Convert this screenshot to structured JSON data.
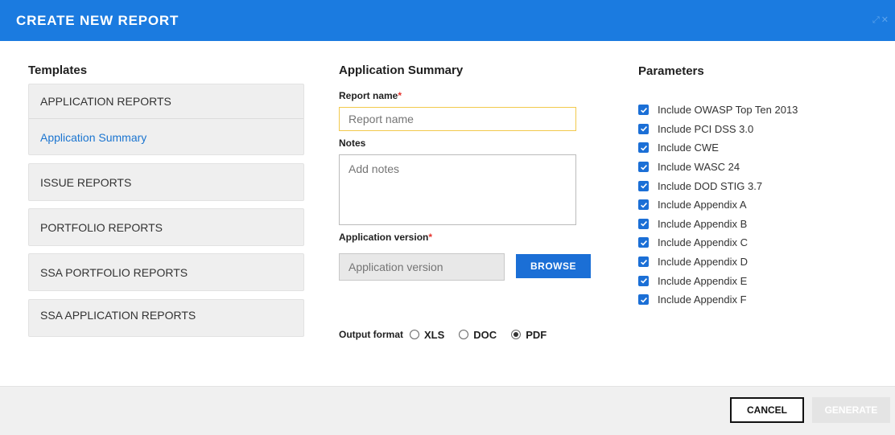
{
  "dialog": {
    "title": "CREATE NEW REPORT",
    "accent": "#1b7be0"
  },
  "templates": {
    "heading": "Templates",
    "groups": [
      {
        "label": "APPLICATION REPORTS",
        "items": [
          "Application Summary"
        ]
      },
      {
        "label": "ISSUE REPORTS"
      },
      {
        "label": "PORTFOLIO REPORTS"
      },
      {
        "label": "SSA PORTFOLIO REPORTS"
      },
      {
        "label": "SSA APPLICATION REPORTS"
      }
    ]
  },
  "form": {
    "heading": "Application Summary",
    "report_name": {
      "label": "Report name",
      "required_mark": "*",
      "value": "",
      "placeholder": "Report name"
    },
    "notes": {
      "label": "Notes",
      "value": "",
      "placeholder": "Add notes"
    },
    "app_version": {
      "label": "Application version",
      "required_mark": "*",
      "value": "",
      "placeholder": "Application version"
    },
    "browse_label": "BROWSE",
    "output": {
      "label": "Output format",
      "options": [
        "XLS",
        "DOC",
        "PDF"
      ],
      "selected": "PDF"
    }
  },
  "parameters": {
    "heading": "Parameters",
    "items": [
      {
        "label": "Include OWASP Top Ten 2013",
        "checked": true
      },
      {
        "label": "Include PCI DSS 3.0",
        "checked": true
      },
      {
        "label": "Include CWE",
        "checked": true
      },
      {
        "label": "Include WASC 24",
        "checked": true
      },
      {
        "label": "Include DOD STIG 3.7",
        "checked": true
      },
      {
        "label": "Include Appendix A",
        "checked": true
      },
      {
        "label": "Include Appendix B",
        "checked": true
      },
      {
        "label": "Include Appendix C",
        "checked": true
      },
      {
        "label": "Include Appendix D",
        "checked": true
      },
      {
        "label": "Include Appendix E",
        "checked": true
      },
      {
        "label": "Include Appendix F",
        "checked": true
      }
    ]
  },
  "footer": {
    "cancel_label": "CANCEL",
    "generate_label": "GENERATE"
  },
  "icons": {
    "expand": "expand-icon",
    "close": "close-icon",
    "checkbox_checked": "checkbox-checked-icon",
    "radio": "radio-icon"
  }
}
